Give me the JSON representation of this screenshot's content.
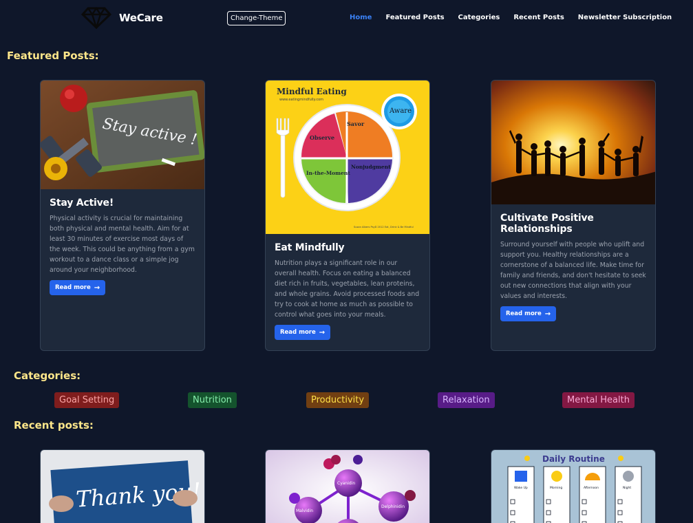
{
  "brand": {
    "name": "WeCare",
    "logo_icon": "diamond-icon"
  },
  "theme_button": {
    "label": "Change-Theme"
  },
  "nav": [
    {
      "label": "Home",
      "active": true
    },
    {
      "label": "Featured Posts",
      "active": false
    },
    {
      "label": "Categories",
      "active": false
    },
    {
      "label": "Recent Posts",
      "active": false
    },
    {
      "label": "Newsletter Subscription",
      "active": false
    }
  ],
  "featured": {
    "heading": "Featured Posts:",
    "posts": [
      {
        "title": "Stay Active!",
        "text": "Physical activity is crucial for maintaining both physical and mental health. Aim for at least 30 minutes of exercise most days of the week. This could be anything from a gym workout to a dance class or a simple jog around your neighborhood.",
        "button": "Read more",
        "image_caption": "Stay active !"
      },
      {
        "title": "Eat Mindfully",
        "text": "Nutrition plays a significant role in our overall health. Focus on eating a balanced diet rich in fruits, vegetables, lean proteins, and whole grains. Avoid processed foods and try to cook at home as much as possible to control what goes into your meals.",
        "button": "Read more",
        "image": {
          "title": "Mindful Eating",
          "url": "www.eatingmindfully.com",
          "aware": "Aware",
          "aware_sub": "Tuning in, nonjudg. knowing",
          "observe": "Observe",
          "savor": "Savor",
          "in_the_moment": "In-the-Moment",
          "nonjudgment": "Nonjudgment",
          "footer": "Susan Albers PsyD 2012 Eat, Drink & Be Mindful"
        }
      },
      {
        "title": "Cultivate Positive Relationships",
        "text": "Surround yourself with people who uplift and support you. Healthy relationships are a cornerstone of a balanced life. Make time for family and friends, and don't hesitate to seek out new connections that align with your values and interests.",
        "button": "Read more"
      }
    ]
  },
  "categories": {
    "heading": "Categories:",
    "items": [
      {
        "label": "Goal Setting",
        "bg": "#7f1d1d",
        "fg": "#fca5a5"
      },
      {
        "label": "Nutrition",
        "bg": "#14532d",
        "fg": "#86efac"
      },
      {
        "label": "Productivity",
        "bg": "#713f12",
        "fg": "#fde047"
      },
      {
        "label": "Relaxation",
        "bg": "#581c87",
        "fg": "#d8b4fe"
      },
      {
        "label": "Mental Health",
        "bg": "#831843",
        "fg": "#f9a8d4"
      }
    ]
  },
  "recent": {
    "heading": "Recent posts:",
    "posts": [
      {
        "image_text": "Thank you!"
      },
      {
        "image_labels": [
          "Cyanidin",
          "Malvidin",
          "Delphinidin"
        ]
      },
      {
        "image_title": "Daily Routine",
        "columns": [
          "Wake Up",
          "Morning",
          "Afternoon",
          "Night"
        ]
      }
    ]
  },
  "colors": {
    "background": "#0f172a",
    "card": "#1e293b",
    "accent": "#2563eb",
    "heading": "#fde68a",
    "active_nav": "#3b82f6"
  }
}
